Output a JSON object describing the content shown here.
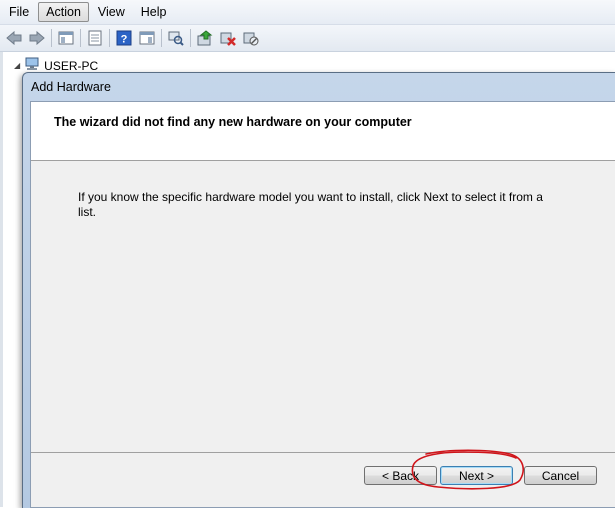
{
  "menubar": {
    "items": [
      {
        "label": "File"
      },
      {
        "label": "Action"
      },
      {
        "label": "View"
      },
      {
        "label": "Help"
      }
    ]
  },
  "toolbar": {
    "icons": [
      "back-arrow-icon",
      "forward-arrow-icon",
      "show-hide-tree-icon",
      "properties-icon",
      "help-icon",
      "action-pane-icon",
      "scan-hardware-icon",
      "update-driver-icon",
      "uninstall-icon",
      "disable-icon"
    ]
  },
  "tree": {
    "root_label": "USER-PC"
  },
  "wizard": {
    "title": "Add Hardware",
    "header_title": "The wizard did not find any new hardware on your computer",
    "body_text": "If you know the specific hardware model you want to install, click Next to select it from a list.",
    "back_label": "< Back",
    "next_label": "Next >",
    "cancel_label": "Cancel"
  },
  "colors": {
    "annotation": "#d0141a",
    "title_bar": "#bcd0e8"
  }
}
